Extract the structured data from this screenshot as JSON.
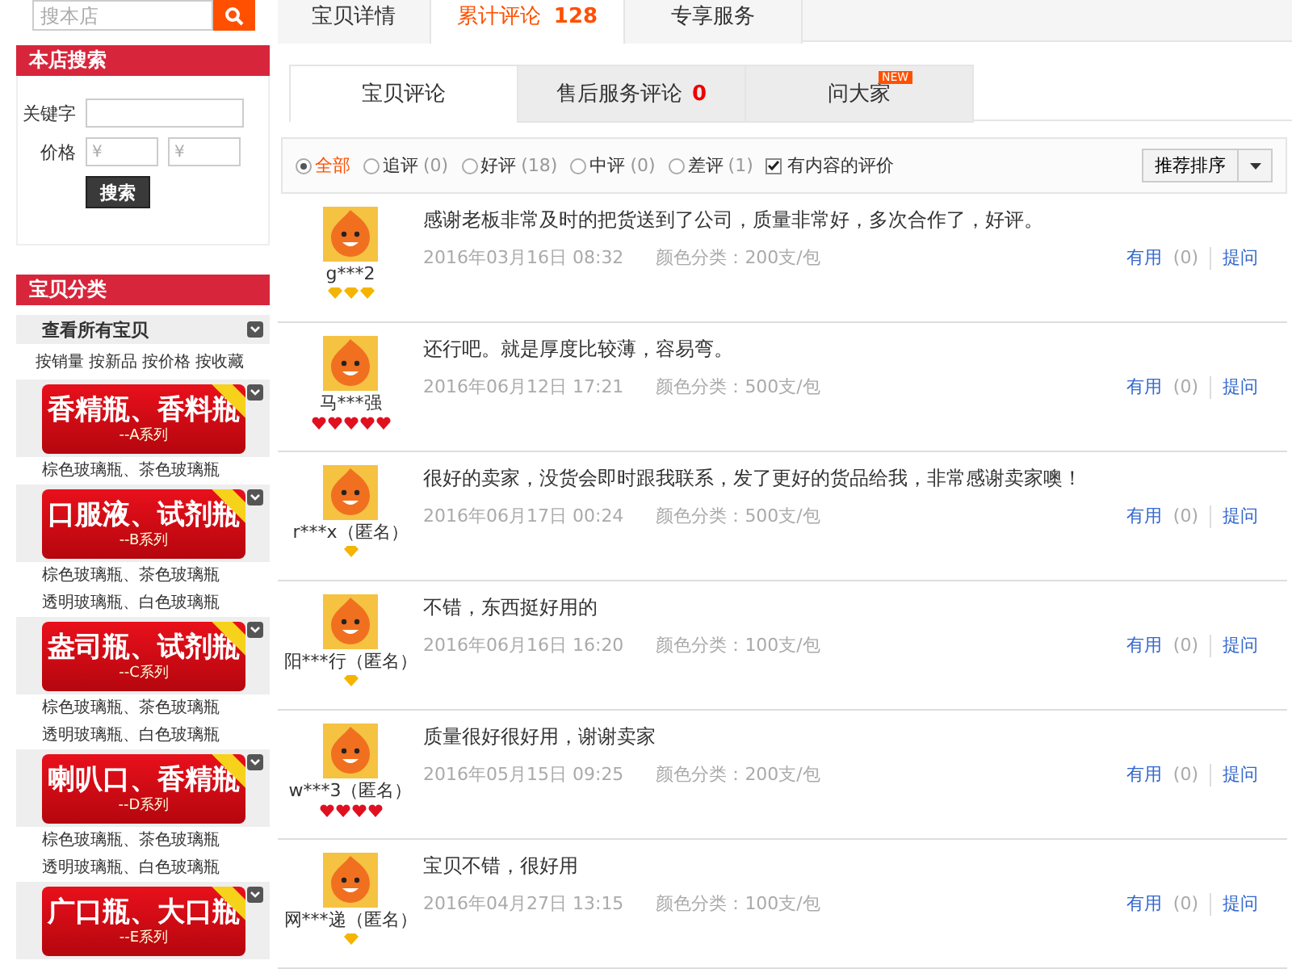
{
  "store_search_bar": {
    "placeholder": "搜本店"
  },
  "store_search": {
    "title": "本店搜索",
    "keyword_label": "关键字",
    "price_label": "价格",
    "price_min_placeholder": "¥",
    "price_max_placeholder": "¥",
    "button": "搜索"
  },
  "categories": {
    "title": "宝贝分类",
    "all_label": "查看所有宝贝",
    "sort_links": [
      "按销量",
      "按新品",
      "按价格",
      "按收藏"
    ],
    "items": [
      {
        "title": "香精瓶、香料瓶",
        "series": "--A系列",
        "subitems": [
          "棕色玻璃瓶、茶色玻璃瓶"
        ]
      },
      {
        "title": "口服液、试剂瓶",
        "series": "--B系列",
        "subitems": [
          "棕色玻璃瓶、茶色玻璃瓶",
          "透明玻璃瓶、白色玻璃瓶"
        ]
      },
      {
        "title": "盎司瓶、试剂瓶",
        "series": "--C系列",
        "subitems": [
          "棕色玻璃瓶、茶色玻璃瓶",
          "透明玻璃瓶、白色玻璃瓶"
        ]
      },
      {
        "title": "喇叭口、香精瓶",
        "series": "--D系列",
        "subitems": [
          "棕色玻璃瓶、茶色玻璃瓶",
          "透明玻璃瓶、白色玻璃瓶"
        ]
      },
      {
        "title": "广口瓶、大口瓶",
        "series": "--E系列"
      }
    ]
  },
  "tabs": [
    {
      "label": "宝贝详情",
      "selected": false
    },
    {
      "label": "累计评论",
      "count": "128",
      "selected": true
    },
    {
      "label": "专享服务",
      "selected": false
    }
  ],
  "sub_tabs": [
    {
      "label": "宝贝评论",
      "selected": true
    },
    {
      "label": "售后服务评论",
      "count": "0",
      "selected": false
    },
    {
      "label": "问大家",
      "badge": "NEW",
      "selected": false
    }
  ],
  "filters": [
    {
      "label": "全部",
      "selected": true
    },
    {
      "label": "追评",
      "count": "(0)",
      "selected": false
    },
    {
      "label": "好评",
      "count": "(18)",
      "selected": false
    },
    {
      "label": "中评",
      "count": "(0)",
      "selected": false
    },
    {
      "label": "差评",
      "count": "(1)",
      "selected": false
    }
  ],
  "content_filter": {
    "label": "有内容的评价",
    "checked": true
  },
  "sort": {
    "label": "推荐排序"
  },
  "reviews": [
    {
      "user": "g***2",
      "rank": [
        {
          "kind": "diamond"
        },
        {
          "kind": "diamond"
        },
        {
          "kind": "diamond"
        }
      ],
      "text": "感谢老板非常及时的把货送到了公司，质量非常好，多次合作了，好评。",
      "date": "2016年03月16日 08:32",
      "variant": "颜色分类：200支/包",
      "useful_label": "有用",
      "useful_count": "(0)",
      "ask_label": "提问"
    },
    {
      "user": "马***强",
      "rank": [
        {
          "kind": "heart"
        },
        {
          "kind": "heart"
        },
        {
          "kind": "heart"
        },
        {
          "kind": "heart"
        },
        {
          "kind": "heart"
        }
      ],
      "text": "还行吧。就是厚度比较薄，容易弯。",
      "date": "2016年06月12日 17:21",
      "variant": "颜色分类：500支/包",
      "useful_label": "有用",
      "useful_count": "(0)",
      "ask_label": "提问"
    },
    {
      "user": "r***x（匿名）",
      "rank": [
        {
          "kind": "diamond"
        }
      ],
      "text": "很好的卖家，没货会即时跟我联系，发了更好的货品给我，非常感谢卖家噢！",
      "date": "2016年06月17日 00:24",
      "variant": "颜色分类：500支/包",
      "useful_label": "有用",
      "useful_count": "(0)",
      "ask_label": "提问"
    },
    {
      "user": "阳***行（匿名）",
      "rank": [
        {
          "kind": "diamond"
        }
      ],
      "text": "不错，东西挺好用的",
      "date": "2016年06月16日 16:20",
      "variant": "颜色分类：100支/包",
      "useful_label": "有用",
      "useful_count": "(0)",
      "ask_label": "提问"
    },
    {
      "user": "w***3（匿名）",
      "rank": [
        {
          "kind": "heart"
        },
        {
          "kind": "heart"
        },
        {
          "kind": "heart"
        },
        {
          "kind": "heart"
        }
      ],
      "text": "质量很好很好用，谢谢卖家",
      "date": "2016年05月15日 09:25",
      "variant": "颜色分类：200支/包",
      "useful_label": "有用",
      "useful_count": "(0)",
      "ask_label": "提问"
    },
    {
      "user": "网***递（匿名）",
      "rank": [
        {
          "kind": "diamond"
        }
      ],
      "text": "宝贝不错，很好用",
      "date": "2016年04月27日 13:15",
      "variant": "颜色分类：100支/包",
      "useful_label": "有用",
      "useful_count": "(0)",
      "ask_label": "提问"
    }
  ]
}
